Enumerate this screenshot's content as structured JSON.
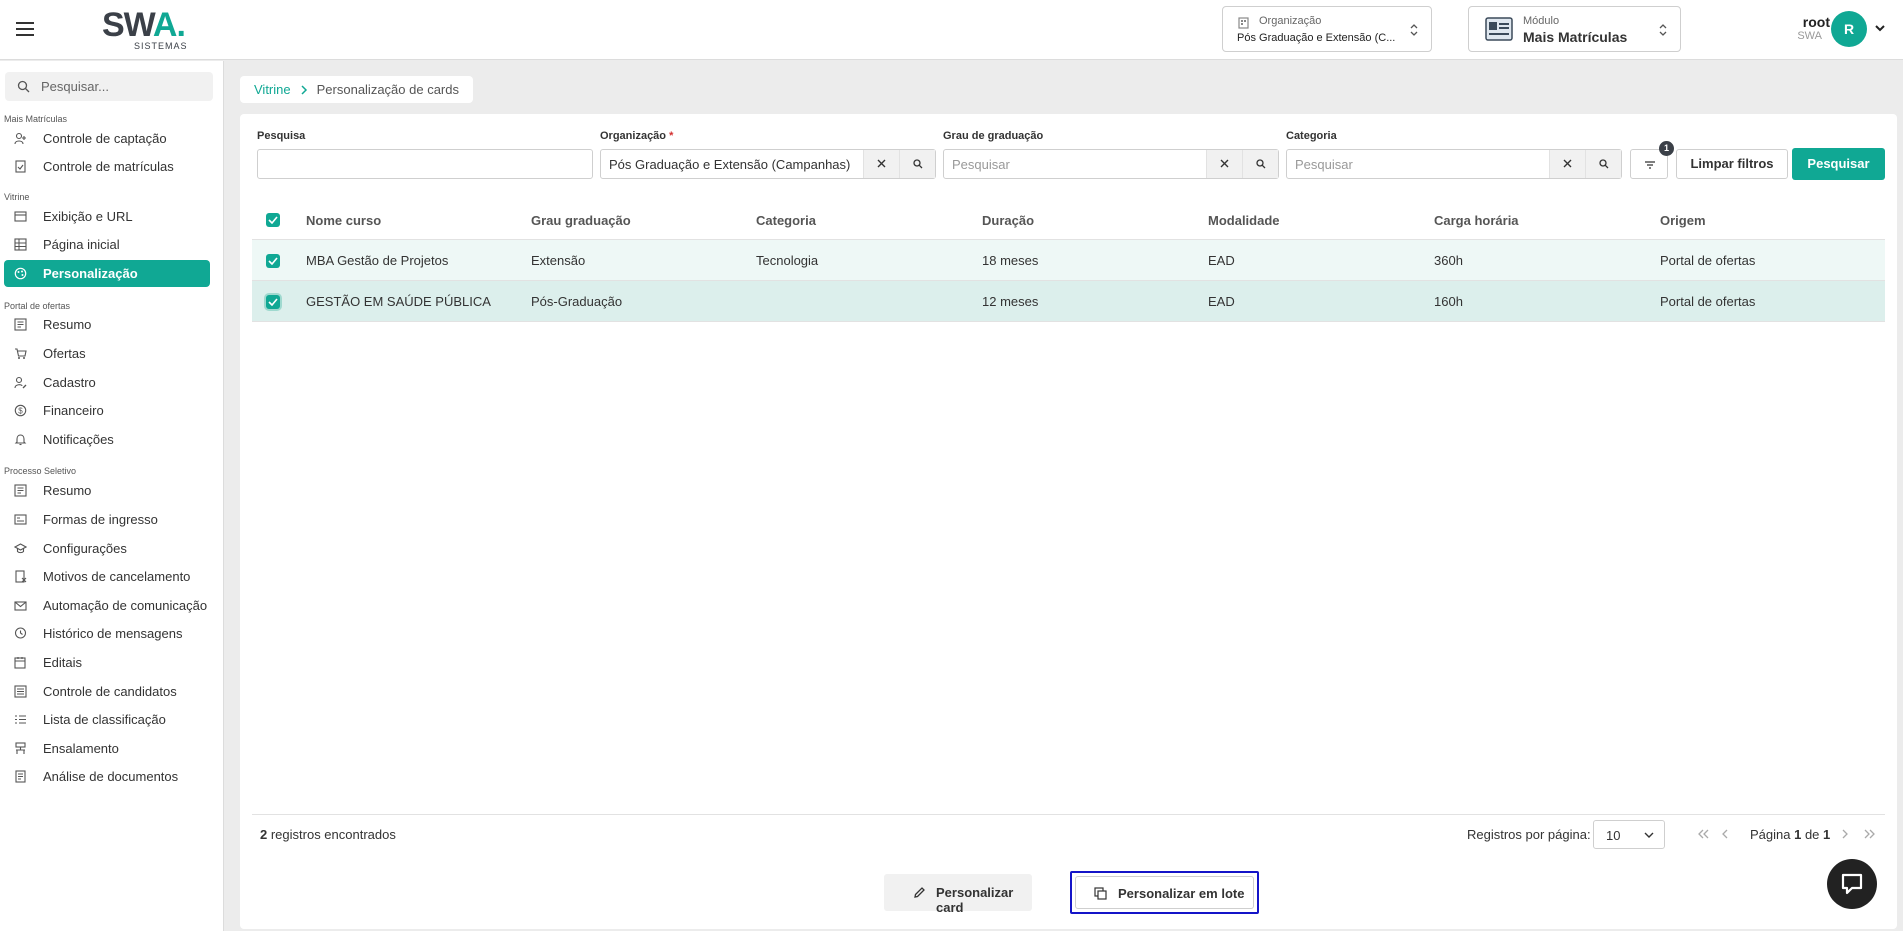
{
  "header": {
    "logo_text_a": "SW",
    "logo_text_b": "A.",
    "logo_sub": "SISTEMAS",
    "org_label": "Organização",
    "org_value": "Pós Graduação e Extensão (C...",
    "module_label": "Módulo",
    "module_value": "Mais Matrículas",
    "user_name": "root",
    "user_sub": "SWA",
    "avatar_initial": "R"
  },
  "sidebar": {
    "search_placeholder": "Pesquisar...",
    "sections": [
      {
        "label": "Mais Matrículas",
        "items": [
          {
            "label": "Controle de captação",
            "icon": "user-add-icon"
          },
          {
            "label": "Controle de matrículas",
            "icon": "document-check-icon"
          }
        ]
      },
      {
        "label": "Vitrine",
        "items": [
          {
            "label": "Exibição e URL",
            "icon": "browser-icon"
          },
          {
            "label": "Página inicial",
            "icon": "grid-icon"
          },
          {
            "label": "Personalização",
            "icon": "palette-icon",
            "active": true
          }
        ]
      },
      {
        "label": "Portal de ofertas",
        "items": [
          {
            "label": "Resumo",
            "icon": "summary-icon"
          },
          {
            "label": "Ofertas",
            "icon": "cart-icon"
          },
          {
            "label": "Cadastro",
            "icon": "user-edit-icon"
          },
          {
            "label": "Financeiro",
            "icon": "dollar-icon"
          },
          {
            "label": "Notificações",
            "icon": "bell-icon"
          }
        ]
      },
      {
        "label": "Processo Seletivo",
        "items": [
          {
            "label": "Resumo",
            "icon": "summary-icon"
          },
          {
            "label": "Formas de ingresso",
            "icon": "form-icon"
          },
          {
            "label": "Configurações",
            "icon": "graduation-cap-icon"
          },
          {
            "label": "Motivos de cancelamento",
            "icon": "document-x-icon"
          },
          {
            "label": "Automação de comunicação",
            "icon": "mail-icon"
          },
          {
            "label": "Histórico de mensagens",
            "icon": "chat-history-icon"
          },
          {
            "label": "Editais",
            "icon": "calendar-edit-icon"
          },
          {
            "label": "Controle de candidatos",
            "icon": "list-icon"
          },
          {
            "label": "Lista de classificação",
            "icon": "ranking-icon"
          },
          {
            "label": "Ensalamento",
            "icon": "classroom-icon"
          },
          {
            "label": "Análise de documentos",
            "icon": "document-search-icon"
          }
        ]
      }
    ]
  },
  "breadcrumb": {
    "root": "Vitrine",
    "current": "Personalização de cards"
  },
  "filters": {
    "search_label": "Pesquisa",
    "search_value": "",
    "org_label": "Organização",
    "org_required": "*",
    "org_value": "Pós Graduação e Extensão (Campanhas)",
    "grau_label": "Grau de graduação",
    "grau_placeholder": "Pesquisar",
    "categoria_label": "Categoria",
    "categoria_placeholder": "Pesquisar",
    "filter_badge": "1",
    "clear_label": "Limpar filtros",
    "search_button": "Pesquisar"
  },
  "table": {
    "columns": [
      "Nome curso",
      "Grau graduação",
      "Categoria",
      "Duração",
      "Modalidade",
      "Carga horária",
      "Origem"
    ],
    "rows": [
      {
        "selected": true,
        "cells": [
          "MBA Gestão de Projetos",
          "Extensão",
          "Tecnologia",
          "18 meses",
          "EAD",
          "360h",
          "Portal de ofertas"
        ]
      },
      {
        "selected": true,
        "cells": [
          "GESTÃO EM SAÚDE PÚBLICA",
          "Pós-Graduação",
          "",
          "12 meses",
          "EAD",
          "160h",
          "Portal de ofertas"
        ]
      }
    ]
  },
  "footer": {
    "records_count": "2",
    "records_text": " registros encontrados",
    "rpp_label": "Registros por página:",
    "rpp_value": "10",
    "page_prefix": "Página ",
    "page_current": "1",
    "page_sep": " de ",
    "page_total": "1"
  },
  "actions": {
    "customize_card": "Personalizar card",
    "customize_batch": "Personalizar em lote"
  },
  "colors": {
    "accent": "#10a894",
    "highlight_border": "#1414c8",
    "row_selected": "#dcefec"
  }
}
